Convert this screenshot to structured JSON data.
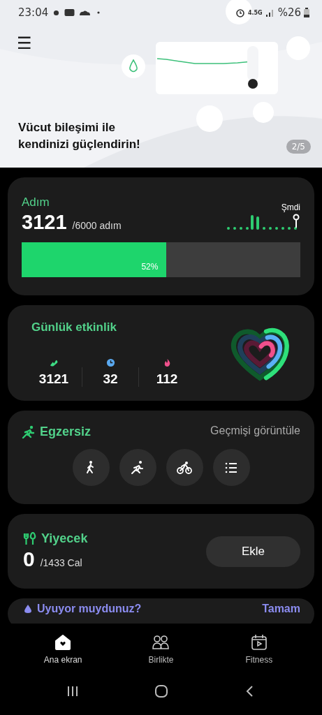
{
  "status_bar": {
    "time": "23:04",
    "network": "4.5G",
    "battery": "%26"
  },
  "banner": {
    "menu": "☰",
    "title": "Vücut bileşimi ile kendinizi güçlendirin!",
    "page": "2/5"
  },
  "steps": {
    "title": "Adım",
    "count": "3121",
    "goal": "/6000 adım",
    "now_label": "Şmdi",
    "level": 0.52,
    "percent": "52%"
  },
  "activity": {
    "title": "Günlük etkinlik",
    "stats": [
      {
        "kind": "steps",
        "value": "3121",
        "color": "#3ddc84"
      },
      {
        "kind": "time",
        "value": "32",
        "color": "#5aa9f0"
      },
      {
        "kind": "calories",
        "value": "112",
        "color": "#f0508c"
      }
    ]
  },
  "exercise": {
    "title": "Egzersiz",
    "link": "Geçmişi görüntüle",
    "types": [
      {
        "kind": "walk"
      },
      {
        "kind": "run"
      },
      {
        "kind": "cycle"
      },
      {
        "kind": "list"
      }
    ]
  },
  "food": {
    "title": "Yiyecek",
    "count": "0",
    "goal": "/1433 Cal",
    "button": "Ekle"
  },
  "sleep": {
    "title": "Uyuyor muydunuz?",
    "action": "Tamam"
  },
  "bottom_nav": [
    {
      "kind": "home",
      "label": "Ana ekran",
      "selected": true
    },
    {
      "kind": "together",
      "label": "Birlikte",
      "selected": false
    },
    {
      "kind": "fitness",
      "label": "Fitness",
      "selected": false
    }
  ]
}
